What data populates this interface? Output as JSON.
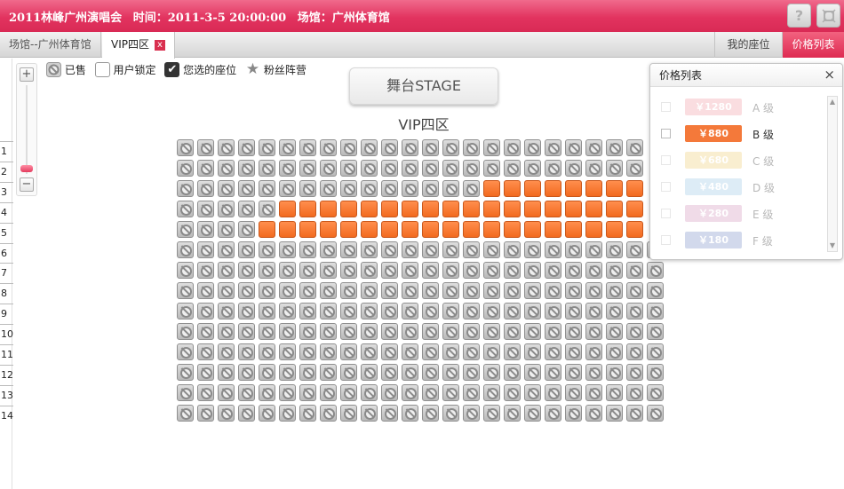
{
  "title_bar": {
    "event": "2011林峰广州演唱会",
    "time": "时间：2011-3-5 20:00:00",
    "venue": "场馆：广州体育馆",
    "help_label": "?",
    "fullscreen_icon": "expand-icon"
  },
  "tabs": {
    "venue_tab": "场馆--广州体育馆",
    "zone_tab": "VIP四区",
    "close_mark": "x",
    "my_seats": "我的座位",
    "price_list": "价格列表"
  },
  "zoom": {
    "plus": "+",
    "minus": "−",
    "level": 0.9
  },
  "legend": {
    "sold": "已售",
    "locked": "用户锁定",
    "selected": "您选的座位",
    "fan": "粉丝阵营"
  },
  "stage_label": "舞台STAGE",
  "zone_title": "VIP四区",
  "row_numbers": [
    "1",
    "2",
    "3",
    "4",
    "5",
    "6",
    "7",
    "8",
    "9",
    "10",
    "11",
    "12",
    "13",
    "14"
  ],
  "seat_map": {
    "columns": 24,
    "rows": [
      {
        "row": 1,
        "seats": 23,
        "available_from": null,
        "available_to": null
      },
      {
        "row": 2,
        "seats": 23,
        "available_from": null,
        "available_to": null
      },
      {
        "row": 3,
        "seats": 23,
        "available_from": 16,
        "available_to": 23
      },
      {
        "row": 4,
        "seats": 23,
        "available_from": 6,
        "available_to": 23
      },
      {
        "row": 5,
        "seats": 23,
        "available_from": 5,
        "available_to": 23
      },
      {
        "row": 6,
        "seats": 24,
        "available_from": null,
        "available_to": null
      },
      {
        "row": 7,
        "seats": 24,
        "available_from": null,
        "available_to": null
      },
      {
        "row": 8,
        "seats": 24,
        "available_from": null,
        "available_to": null
      },
      {
        "row": 9,
        "seats": 24,
        "available_from": null,
        "available_to": null
      },
      {
        "row": 10,
        "seats": 24,
        "available_from": null,
        "available_to": null
      },
      {
        "row": 11,
        "seats": 24,
        "available_from": null,
        "available_to": null
      },
      {
        "row": 12,
        "seats": 24,
        "available_from": null,
        "available_to": null
      },
      {
        "row": 13,
        "seats": 24,
        "available_from": null,
        "available_to": null
      },
      {
        "row": 14,
        "seats": 24,
        "available_from": null,
        "available_to": null
      }
    ]
  },
  "price_panel": {
    "title": "价格列表",
    "close": "×",
    "items": [
      {
        "price": "￥1280",
        "level": "A 级",
        "color": "#f2a0a8",
        "dim": true
      },
      {
        "price": "￥880",
        "level": "B 级",
        "color": "#f4793a",
        "dim": false
      },
      {
        "price": "￥680",
        "level": "C 级",
        "color": "#f0d07a",
        "dim": true
      },
      {
        "price": "￥480",
        "level": "D 级",
        "color": "#9fcbe6",
        "dim": true
      },
      {
        "price": "￥280",
        "level": "E 级",
        "color": "#d69ac0",
        "dim": true
      },
      {
        "price": "￥180",
        "level": "F 级",
        "color": "#7f93c9",
        "dim": true
      }
    ]
  },
  "colors": {
    "accent": "#e2335f",
    "available": "#f4793a",
    "sold": "#c8c8c8"
  }
}
